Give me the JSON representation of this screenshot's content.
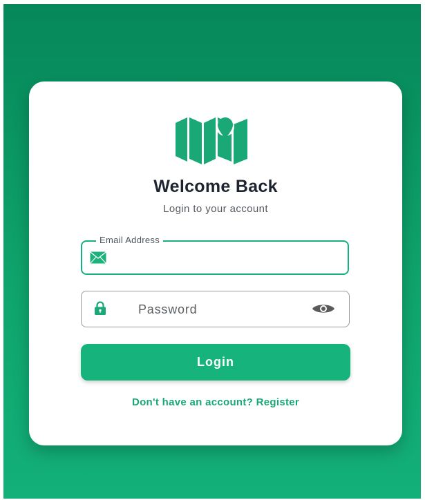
{
  "colors": {
    "background_top": "#06875a",
    "background_bottom": "#13b07a",
    "accent": "#16b37d",
    "title": "#1e2530",
    "link": "#17a874"
  },
  "header": {
    "logo_icon": "map-pin-logo-icon",
    "title": "Welcome Back",
    "subtitle": "Login to your account"
  },
  "form": {
    "email": {
      "label": "Email Address",
      "value": "",
      "icon": "envelope-icon"
    },
    "password": {
      "placeholder": "Password",
      "value": "",
      "icon": "lock-icon",
      "toggle_icon": "eye-icon"
    },
    "login_label": "Login"
  },
  "footer": {
    "register_text": "Don't have an account? Register"
  }
}
